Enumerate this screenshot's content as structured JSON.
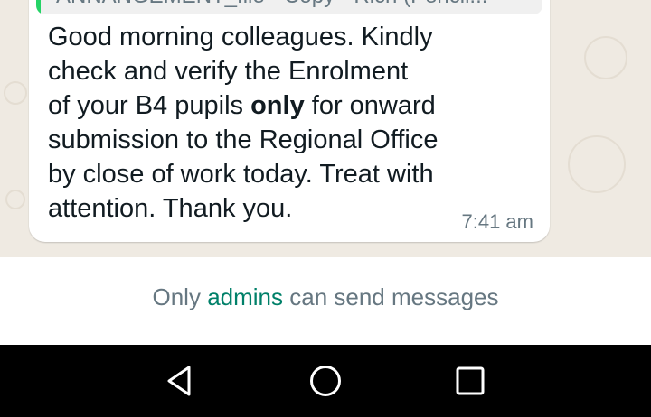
{
  "chat": {
    "quoted_preview": "ANNANGEMENT_file - Copy - Rich (Pencil...",
    "message_lines": [
      {
        "text": "Good morning colleagues. Kindly"
      },
      {
        "text": "check and verify the Enrolment"
      },
      {
        "pre": "of your B4 pupils ",
        "bold": "only",
        "post": " for onward"
      },
      {
        "text": "submission to  the Regional Office"
      },
      {
        "text": "by close of work today. Treat with"
      },
      {
        "text": "attention. Thank you."
      }
    ],
    "timestamp": "7:41 am"
  },
  "notice": {
    "prefix": "Only ",
    "link": "admins",
    "suffix": " can send messages"
  },
  "navbar": {
    "back_icon": "triangle-back-icon",
    "home_icon": "circle-home-icon",
    "recents_icon": "square-recents-icon"
  },
  "colors": {
    "wallpaper": "#efeae2",
    "bubble": "#ffffff",
    "accent": "#008069",
    "quote_bar": "#25d366",
    "navbar": "#000000"
  }
}
